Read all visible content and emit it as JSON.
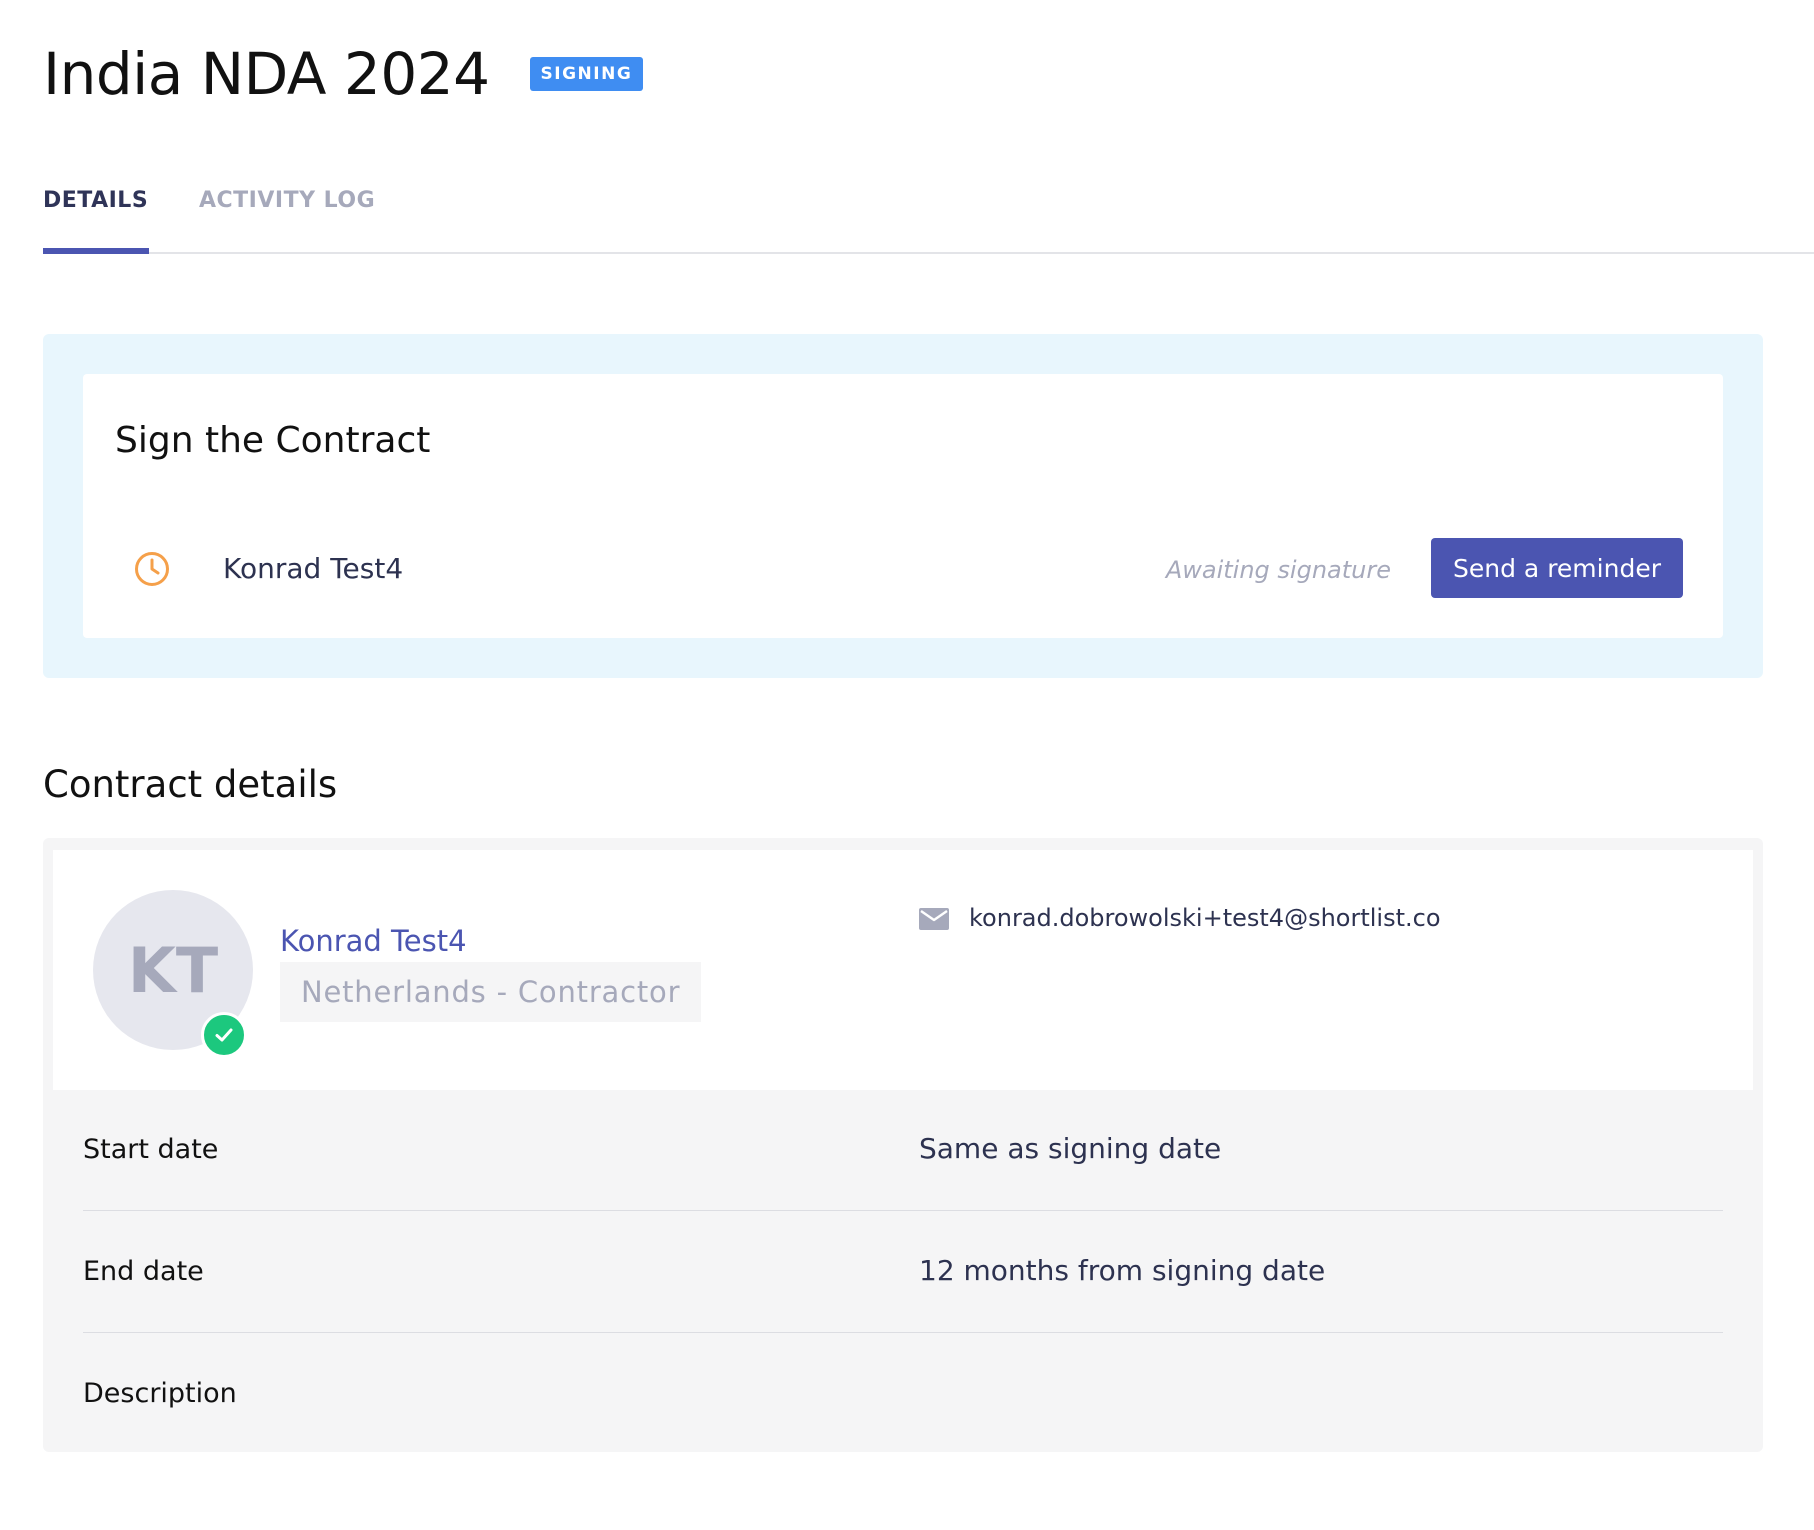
{
  "header": {
    "title": "India NDA 2024",
    "status_badge": "SIGNING"
  },
  "tabs": [
    {
      "label": "DETAILS",
      "active": true
    },
    {
      "label": "ACTIVITY LOG",
      "active": false
    }
  ],
  "sign_panel": {
    "heading": "Sign the Contract",
    "signer": {
      "icon": "clock-icon",
      "name": "Konrad Test4",
      "status": "Awaiting signature"
    },
    "reminder_button_label": "Send a reminder"
  },
  "contract_details": {
    "heading": "Contract details",
    "profile": {
      "initials": "KT",
      "verified": true,
      "name": "Konrad Test4",
      "tag": "Netherlands - Contractor",
      "email": "konrad.dobrowolski+test4@shortlist.co"
    },
    "rows": [
      {
        "label": "Start date",
        "value": "Same as signing date"
      },
      {
        "label": "End date",
        "value": "12 months from signing date"
      },
      {
        "label": "Description",
        "value": ""
      }
    ]
  },
  "colors": {
    "accent": "#4b55b1",
    "badge": "#3f8df2",
    "clock": "#f5a04a",
    "verified": "#1cc87e",
    "panel_bg": "#e8f6fd"
  }
}
